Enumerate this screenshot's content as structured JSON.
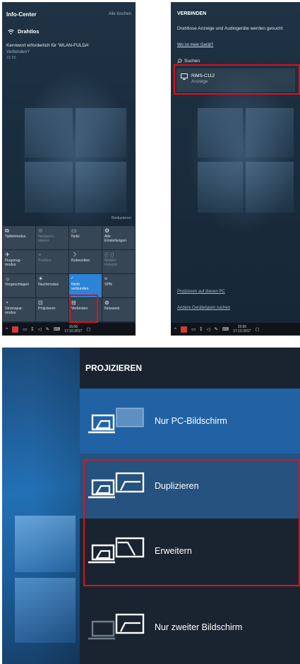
{
  "info_center": {
    "title": "Info-Center",
    "clear_all": "Alle löschen",
    "wifi_group": "Drahtlos",
    "notification": {
      "message": "Kennwort erforderlich für 'WLAN-FULDA'",
      "action": "Verbinden?",
      "time": "15:55"
    },
    "collapse": "Reduzieren",
    "tiles": [
      {
        "icon": "tablet-icon",
        "label": "Tabletmodus",
        "state": "normal"
      },
      {
        "icon": "network-icon",
        "label": "Netzwerk-\nspeere",
        "state": "dim"
      },
      {
        "icon": "note-icon",
        "label": "Notiz",
        "state": "normal"
      },
      {
        "icon": "gear-icon",
        "label": "Alle\nEinstellungen",
        "state": "normal"
      },
      {
        "icon": "airplane-icon",
        "label": "Flugzeug-\nmodus",
        "state": "normal"
      },
      {
        "icon": "location-icon",
        "label": "Position",
        "state": "dim"
      },
      {
        "icon": "moon-icon",
        "label": "Ruhezeiten",
        "state": "normal"
      },
      {
        "icon": "hotspot-icon",
        "label": "Mobiler\nHotspot",
        "state": "dim"
      },
      {
        "icon": "suggest-icon",
        "label": "Vorgeschlagen",
        "state": "normal"
      },
      {
        "icon": "night-icon",
        "label": "Nachtmodus",
        "state": "normal"
      },
      {
        "icon": "wifi-icon",
        "label": "Nicht\nverbunden",
        "state": "on"
      },
      {
        "icon": "vpn-icon",
        "label": "VPN",
        "state": "normal"
      },
      {
        "icon": "battery-icon",
        "label": "Stromspar-\nmodus",
        "state": "normal"
      },
      {
        "icon": "project-icon",
        "label": "Projizieren",
        "state": "normal"
      },
      {
        "icon": "connect-icon",
        "label": "Verbinden",
        "state": "normal"
      },
      {
        "icon": "network-icon",
        "label": "Netzwerk",
        "state": "normal"
      }
    ],
    "taskbar": {
      "time": "15:56",
      "date": "17.10.2017"
    }
  },
  "verbinden": {
    "title": "VERBINDEN",
    "description": "Drahtlose Anzeige und Audiogeräte werden gesucht",
    "help_link": "Wo ist mein Gerät?",
    "search_label": "Suchen",
    "device": {
      "name": "RiMS-C112",
      "type": "Anzeige"
    },
    "project_link": "Projizieren auf diesen PC",
    "other_devices_link": "Andere Gerätetypen suchen",
    "taskbar": {
      "time": "15:56",
      "date": "17.10.2017"
    }
  },
  "projizieren": {
    "title": "PROJIZIEREN",
    "options": [
      {
        "label": "Nur PC-Bildschirm",
        "icon": "pc-screen-only-icon"
      },
      {
        "label": "Duplizieren",
        "icon": "duplicate-icon"
      },
      {
        "label": "Erweitern",
        "icon": "extend-icon"
      },
      {
        "label": "Nur zweiter Bildschirm",
        "icon": "second-screen-only-icon"
      }
    ]
  },
  "colors": {
    "accent": "#2b84d6",
    "highlight_box": "#e0101a",
    "flyout_bg": "#1a2430"
  }
}
